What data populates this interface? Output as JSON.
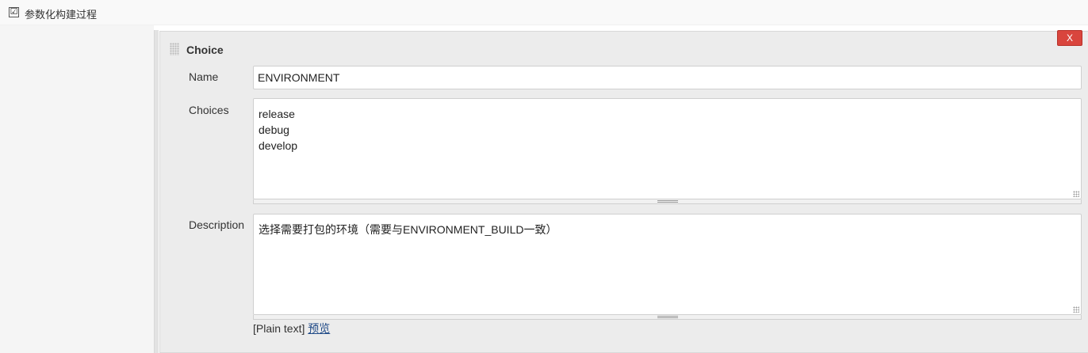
{
  "section": {
    "checkbox_mark": "☑",
    "label": "参数化构建过程"
  },
  "parameter": {
    "title": "Choice",
    "delete_label": "X",
    "name_label": "Name",
    "name_value": "ENVIRONMENT",
    "choices_label": "Choices",
    "choices_value": "release\ndebug\ndevelop",
    "description_label": "Description",
    "description_value": "选择需要打包的环境（需要与ENVIRONMENT_BUILD一致）",
    "format_note": "[Plain text]",
    "preview_link": "预览"
  },
  "colors": {
    "delete_button": "#d9453d",
    "link": "#204a87",
    "panel_background": "#ececec"
  }
}
